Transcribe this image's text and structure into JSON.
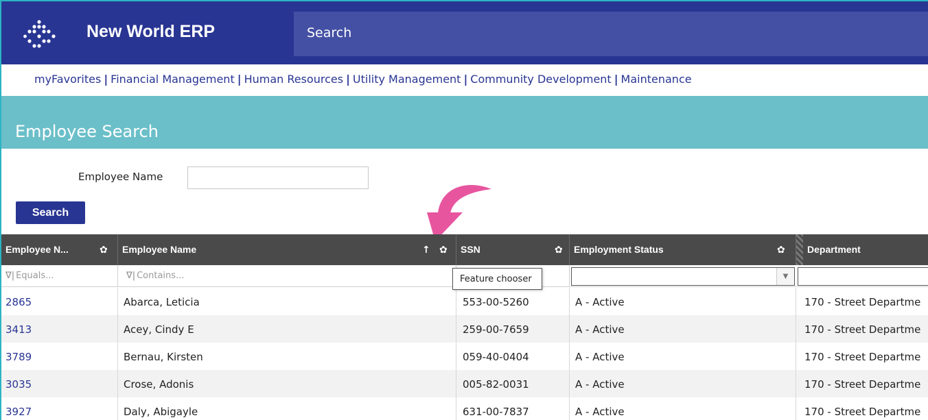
{
  "header": {
    "app_title": "New World ERP",
    "search_text": "Search",
    "brand_color": "#283593"
  },
  "menu": {
    "items": [
      {
        "label": "myFavorites"
      },
      {
        "label": "Financial Management"
      },
      {
        "label": "Human Resources"
      },
      {
        "label": "Utility Management"
      },
      {
        "label": "Community Development"
      },
      {
        "label": "Maintenance"
      }
    ],
    "separator": "|"
  },
  "page": {
    "title": "Employee Search",
    "teal_color": "#6bbfc9"
  },
  "form": {
    "employee_name_label": "Employee Name",
    "employee_name_value": "",
    "search_button": "Search"
  },
  "grid": {
    "columns": [
      {
        "label": "Employee N...",
        "icon": "gear-icon"
      },
      {
        "label": "Employee Name",
        "icon": "gear-icon",
        "sort": "ascending"
      },
      {
        "label": "SSN",
        "icon": "gear-icon"
      },
      {
        "label": "Employment Status",
        "icon": "gear-icon"
      },
      {
        "label": "Department"
      }
    ],
    "filters": {
      "employee_number_placeholder": "Equals...",
      "employee_name_placeholder": "Contains...",
      "employment_status_value": "",
      "department_value": ""
    },
    "rows": [
      {
        "number": "2865",
        "name": "Abarca, Leticia",
        "ssn": "553-00-5260",
        "status": "A - Active",
        "department": "170 - Street Departme"
      },
      {
        "number": "3413",
        "name": "Acey, Cindy E",
        "ssn": "259-00-7659",
        "status": "A - Active",
        "department": "170 - Street Departme"
      },
      {
        "number": "3789",
        "name": "Bernau, Kirsten",
        "ssn": "059-40-0404",
        "status": "A - Active",
        "department": "170 - Street Departme"
      },
      {
        "number": "3035",
        "name": "Crose, Adonis",
        "ssn": "005-82-0031",
        "status": "A - Active",
        "department": "170 - Street Departme"
      },
      {
        "number": "3927",
        "name": "Daly, Abigayle",
        "ssn": "631-00-7837",
        "status": "A - Active",
        "department": "170 - Street Departme"
      }
    ]
  },
  "tooltip": {
    "text": "Feature chooser"
  },
  "annotation": {
    "arrow_color": "#e8559f"
  }
}
